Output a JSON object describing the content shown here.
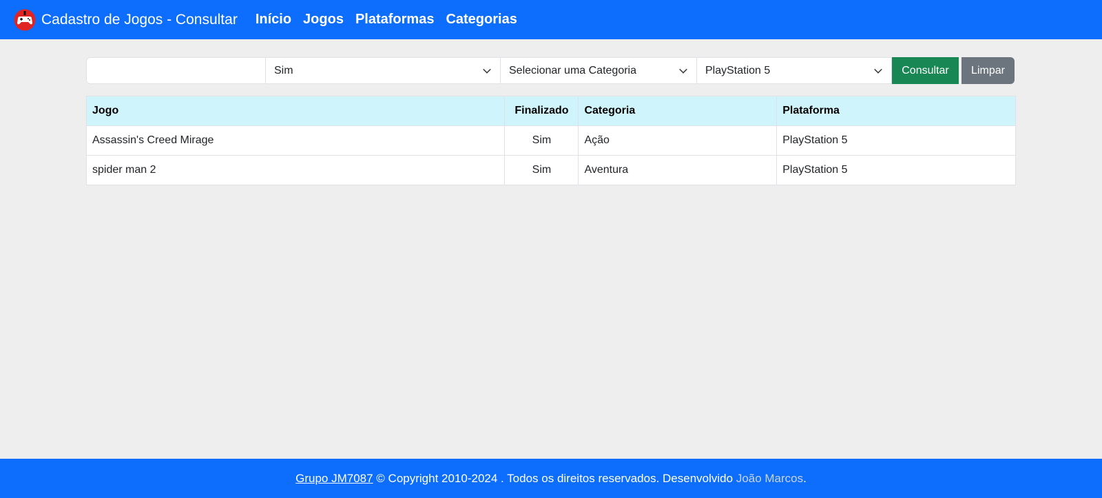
{
  "navbar": {
    "brand": "Cadastro de Jogos - Consultar",
    "logo_icon": "gamepad-icon",
    "links": [
      "Início",
      "Jogos",
      "Plataformas",
      "Categorias"
    ],
    "bg_color": "#0d6efd"
  },
  "filters": {
    "name_value": "",
    "finalizado": "Sim",
    "categoria": "Selecionar uma Categoria",
    "plataforma": "PlayStation 5",
    "consultar_label": "Consultar",
    "limpar_label": "Limpar"
  },
  "table": {
    "headers": [
      "Jogo",
      "Finalizado",
      "Categoria",
      "Plataforma"
    ],
    "rows": [
      [
        "Assassin's Creed Mirage",
        "Sim",
        "Ação",
        "PlayStation 5"
      ],
      [
        "spider man 2",
        "Sim",
        "Aventura",
        "PlayStation 5"
      ]
    ]
  },
  "footer": {
    "group_link": "Grupo JM7087",
    "copyright": "© Copyright 2010-2024 . Todos os direitos reservados. Desenvolvido",
    "developer": "João Marcos",
    "period": "."
  },
  "colors": {
    "primary": "#0d6efd",
    "success": "#198754",
    "secondary": "#6c757d",
    "table_header": "#cff4fc"
  }
}
